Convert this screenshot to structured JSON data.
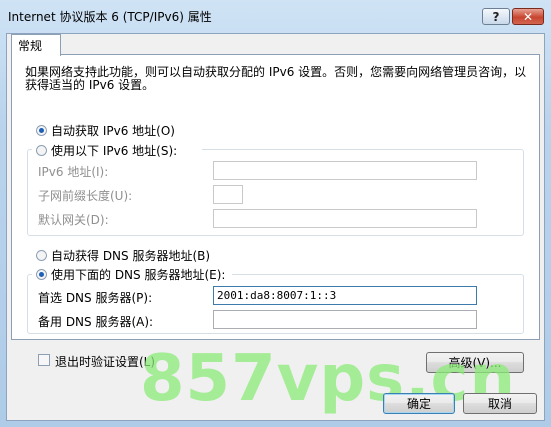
{
  "window": {
    "title": "Internet 协议版本 6 (TCP/IPv6) 属性",
    "help_glyph": "?",
    "close_glyph": "✕"
  },
  "tabs": [
    {
      "label": "常规"
    }
  ],
  "description": "如果网络支持此功能，则可以自动获取分配的 IPv6 设置。否则，您需要向网络管理员咨询，以获得适当的 IPv6 设置。",
  "ip": {
    "auto_label": "自动获取 IPv6 地址(O)",
    "manual_label": "使用以下 IPv6 地址(S):",
    "address_label": "IPv6 地址(I):",
    "prefix_label": "子网前缀长度(U):",
    "gateway_label": "默认网关(D):",
    "address_value": "",
    "prefix_value": "",
    "gateway_value": "",
    "selected": "auto"
  },
  "dns": {
    "auto_label": "自动获得 DNS 服务器地址(B)",
    "manual_label": "使用下面的 DNS 服务器地址(E):",
    "preferred_label": "首选 DNS 服务器(P):",
    "alternate_label": "备用 DNS 服务器(A):",
    "preferred_value": "2001:da8:8007:1::3",
    "alternate_value": "",
    "selected": "manual"
  },
  "validate_on_exit_label": "退出时验证设置(L)",
  "buttons": {
    "advanced": "高级(V)...",
    "ok": "确定",
    "cancel": "取消"
  },
  "watermark": "857vps.cn"
}
